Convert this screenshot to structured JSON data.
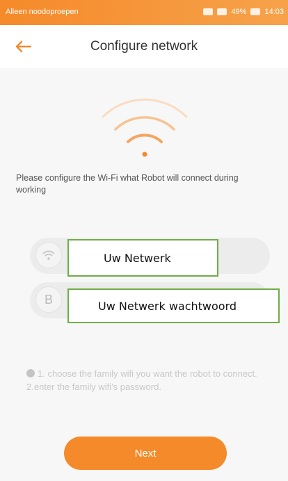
{
  "status_bar": {
    "carrier": "Alleen noodoproepen",
    "battery": "49%",
    "time": "14:03"
  },
  "header": {
    "title": "Configure network",
    "back_icon": "arrow-left-icon"
  },
  "description": "Please configure the Wi-Fi what Robot will connect during working",
  "network_field": {
    "icon": "wifi-icon",
    "overlay_label": "Uw Netwerk"
  },
  "password_field": {
    "icon": "lock-icon",
    "icon_glyph": "B",
    "overlay_label": "Uw Netwerk wachtwoord"
  },
  "instructions": {
    "line1": "1. choose the family wifi you want the robot to connect.",
    "line2": "2.enter the family wifi's password."
  },
  "next_button": "Next",
  "colors": {
    "accent": "#f58a2a",
    "overlay_border": "#70ad47"
  }
}
